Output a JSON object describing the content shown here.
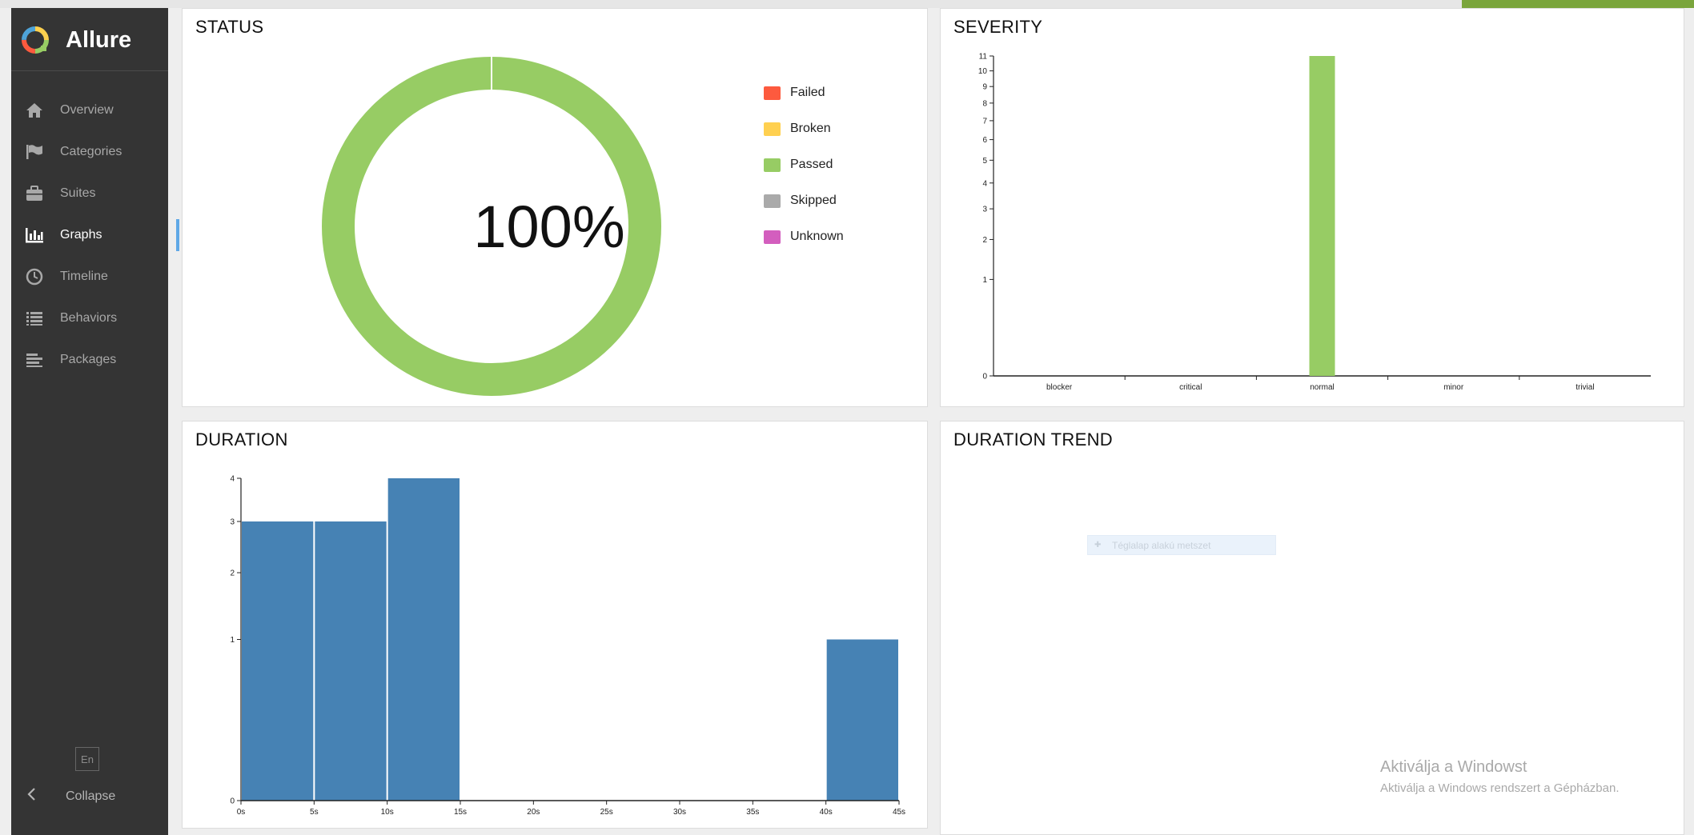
{
  "app": {
    "name": "Allure"
  },
  "sidebar": {
    "items": [
      {
        "label": "Overview",
        "icon": "home-icon"
      },
      {
        "label": "Categories",
        "icon": "flag-icon"
      },
      {
        "label": "Suites",
        "icon": "briefcase-icon"
      },
      {
        "label": "Graphs",
        "icon": "bar-chart-icon",
        "active": true
      },
      {
        "label": "Timeline",
        "icon": "clock-icon"
      },
      {
        "label": "Behaviors",
        "icon": "list-icon"
      },
      {
        "label": "Packages",
        "icon": "align-left-icon"
      }
    ],
    "language": "En",
    "collapse_label": "Collapse"
  },
  "panels": {
    "status": {
      "title": "STATUS",
      "center_label": "100%"
    },
    "severity": {
      "title": "SEVERITY"
    },
    "duration": {
      "title": "DURATION"
    },
    "duration_trend": {
      "title": "DURATION TREND"
    }
  },
  "status_legend": [
    {
      "label": "Failed",
      "color": "#fd5a3e"
    },
    {
      "label": "Broken",
      "color": "#ffd050"
    },
    {
      "label": "Passed",
      "color": "#97cc64"
    },
    {
      "label": "Skipped",
      "color": "#aaaaaa"
    },
    {
      "label": "Unknown",
      "color": "#d35ebe"
    }
  ],
  "chart_data": [
    {
      "type": "pie",
      "title": "STATUS",
      "categories": [
        "Failed",
        "Broken",
        "Passed",
        "Skipped",
        "Unknown"
      ],
      "values": [
        0,
        0,
        100,
        0,
        0
      ],
      "center_label": "100%",
      "legend": "right"
    },
    {
      "type": "bar",
      "title": "SEVERITY",
      "categories": [
        "blocker",
        "critical",
        "normal",
        "minor",
        "trivial"
      ],
      "values": [
        0,
        0,
        11,
        0,
        0
      ],
      "ylim": [
        0,
        11
      ],
      "yscale": "sqrt",
      "yticks": [
        0,
        1,
        2,
        3,
        4,
        5,
        6,
        7,
        8,
        9,
        10,
        11
      ],
      "color": "#97cc64"
    },
    {
      "type": "bar",
      "title": "DURATION",
      "bins": [
        [
          0,
          5
        ],
        [
          5,
          10
        ],
        [
          10,
          15
        ],
        [
          15,
          20
        ],
        [
          20,
          25
        ],
        [
          25,
          30
        ],
        [
          30,
          35
        ],
        [
          35,
          40
        ],
        [
          40,
          45
        ]
      ],
      "values": [
        3,
        3,
        4,
        0,
        0,
        0,
        0,
        0,
        1
      ],
      "xticks": [
        "0s",
        "5s",
        "10s",
        "15s",
        "20s",
        "25s",
        "30s",
        "35s",
        "40s",
        "45s"
      ],
      "ylim": [
        0,
        4
      ],
      "yscale": "sqrt",
      "yticks": [
        0,
        1,
        2,
        3,
        4
      ],
      "color": "#4682b4"
    }
  ],
  "trend_overlay": {
    "text": "Téglalap alakú metszet"
  },
  "windows_activation": {
    "line1": "Aktiválja a Windowst",
    "line2": "Aktiválja a Windows rendszert a Gépházban."
  }
}
